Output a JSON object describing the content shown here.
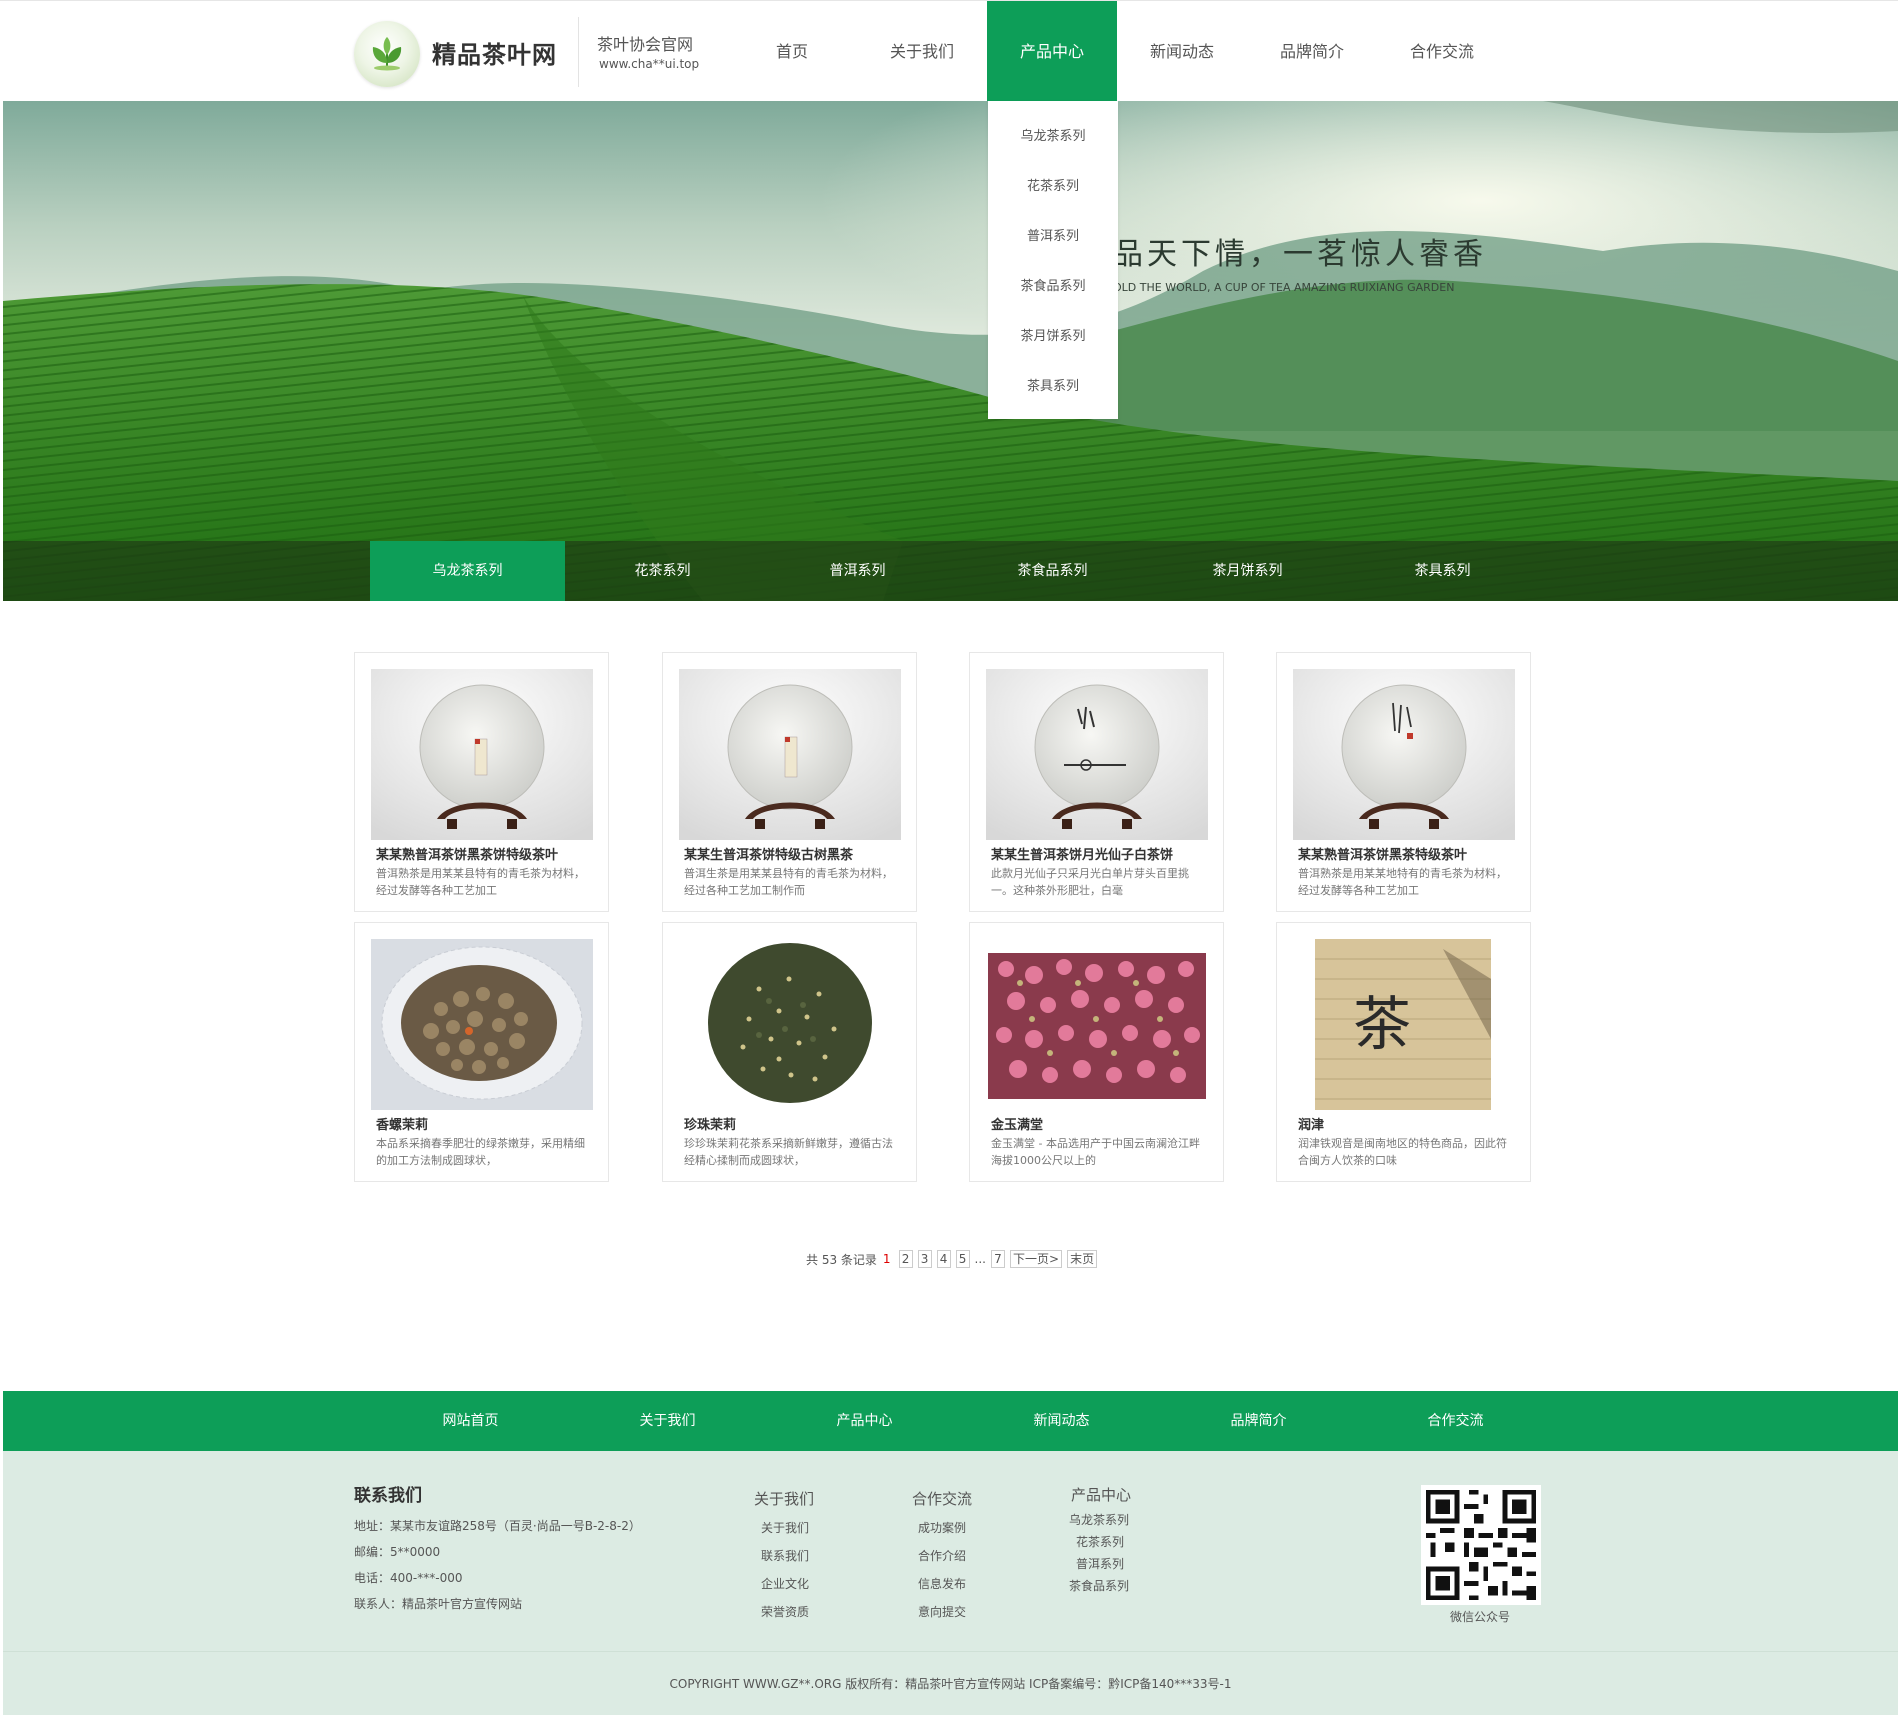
{
  "header": {
    "site_name": "精品茶叶网",
    "association": "茶叶协会官网",
    "url": "www.cha**ui.top",
    "nav": [
      {
        "label": "首页"
      },
      {
        "label": "关于我们"
      },
      {
        "label": "产品中心",
        "active": true
      },
      {
        "label": "新闻动态"
      },
      {
        "label": "品牌简介"
      },
      {
        "label": "合作交流"
      }
    ]
  },
  "dropdown": {
    "items": [
      "乌龙茶系列",
      "花茶系列",
      "普洱系列",
      "茶食品系列",
      "茶月饼系列",
      "茶具系列"
    ]
  },
  "banner": {
    "slogan": "品天下情，一茗惊人睿香",
    "slogan_en": "OLD THE WORLD, A CUP OF TEA AMAZING RUIXIANG GARDEN",
    "category_tabs": [
      {
        "label": "乌龙茶系列",
        "active": true
      },
      {
        "label": "花茶系列"
      },
      {
        "label": "普洱系列"
      },
      {
        "label": "茶食品系列"
      },
      {
        "label": "茶月饼系列"
      },
      {
        "label": "茶具系列"
      }
    ]
  },
  "products": [
    {
      "title": "某某熟普洱茶饼黑茶饼特级茶叶",
      "desc": "普洱熟茶是用某某县特有的青毛茶为材料，经过发酵等各种工艺加工",
      "image": "tea-cake"
    },
    {
      "title": "某某生普洱茶饼特级古树黑茶",
      "desc": "普洱生茶是用某某县特有的青毛茶为材料，经过各种工艺加工制作而",
      "image": "tea-cake"
    },
    {
      "title": "某某生普洱茶饼月光仙子白茶饼",
      "desc": "此款月光仙子只采月光白单片芽头百里挑一。这种茶外形肥壮，白毫",
      "image": "tea-cake"
    },
    {
      "title": "某某熟普洱茶饼黑茶特级茶叶",
      "desc": "普洱熟茶是用某某地特有的青毛茶为材料，经过发酵等各种工艺加工",
      "image": "tea-cake"
    },
    {
      "title": "香螺茉莉",
      "desc": "本品系采摘春季肥壮的绿茶嫩芽，采用精细的加工方法制成圆球状，",
      "image": "jasmine-spiral"
    },
    {
      "title": "珍珠茉莉",
      "desc": "珍珍珠茉莉花茶系采摘新鲜嫩芽，遵循古法经精心揉制而成圆球状，",
      "image": "jasmine-pearl"
    },
    {
      "title": "金玉满堂",
      "desc": "金玉满堂 - 本品选用产于中国云南澜沧江畔海拔1000公尺以上的",
      "image": "rose-buds"
    },
    {
      "title": "润津",
      "desc": "润津铁观音是闽南地区的特色商品，因此符合闽方人饮茶的口味",
      "image": "tea-box"
    }
  ],
  "pagination": {
    "total": "共 53 条记录",
    "current": "1",
    "pages": [
      "2",
      "3",
      "4",
      "5"
    ],
    "ellipsis": "...",
    "last_page": "7",
    "next": "下一页>",
    "end": "末页"
  },
  "footer_nav": [
    "网站首页",
    "关于我们",
    "产品中心",
    "新闻动态",
    "品牌简介",
    "合作交流"
  ],
  "footer": {
    "contact": {
      "title": "联系我们",
      "address": "地址：某某市友谊路258号（百灵·尚品一号B-2-8-2）",
      "postcode": "邮编：5**0000",
      "phone": "电话：400-***-000",
      "contact_person": "联系人：精品茶叶官方宣传网站"
    },
    "columns": [
      {
        "title": "关于我们",
        "items": [
          "关于我们",
          "联系我们",
          "企业文化",
          "荣誉资质"
        ]
      },
      {
        "title": "合作交流",
        "items": [
          "成功案例",
          "合作介绍",
          "信息发布",
          "意向提交"
        ]
      },
      {
        "title": "产品中心",
        "items": [
          "乌龙茶系列",
          "花茶系列",
          "普洱系列",
          "茶食品系列"
        ]
      }
    ],
    "qr_label": "微信公众号",
    "copyright": "COPYRIGHT WWW.GZ**.ORG    版权所有：精品茶叶官方宣传网站    ICP备案编号：黔ICP备140***33号-1"
  },
  "colors": {
    "brand_green": "#0d9e58",
    "footer_bg": "#dcebe3"
  }
}
